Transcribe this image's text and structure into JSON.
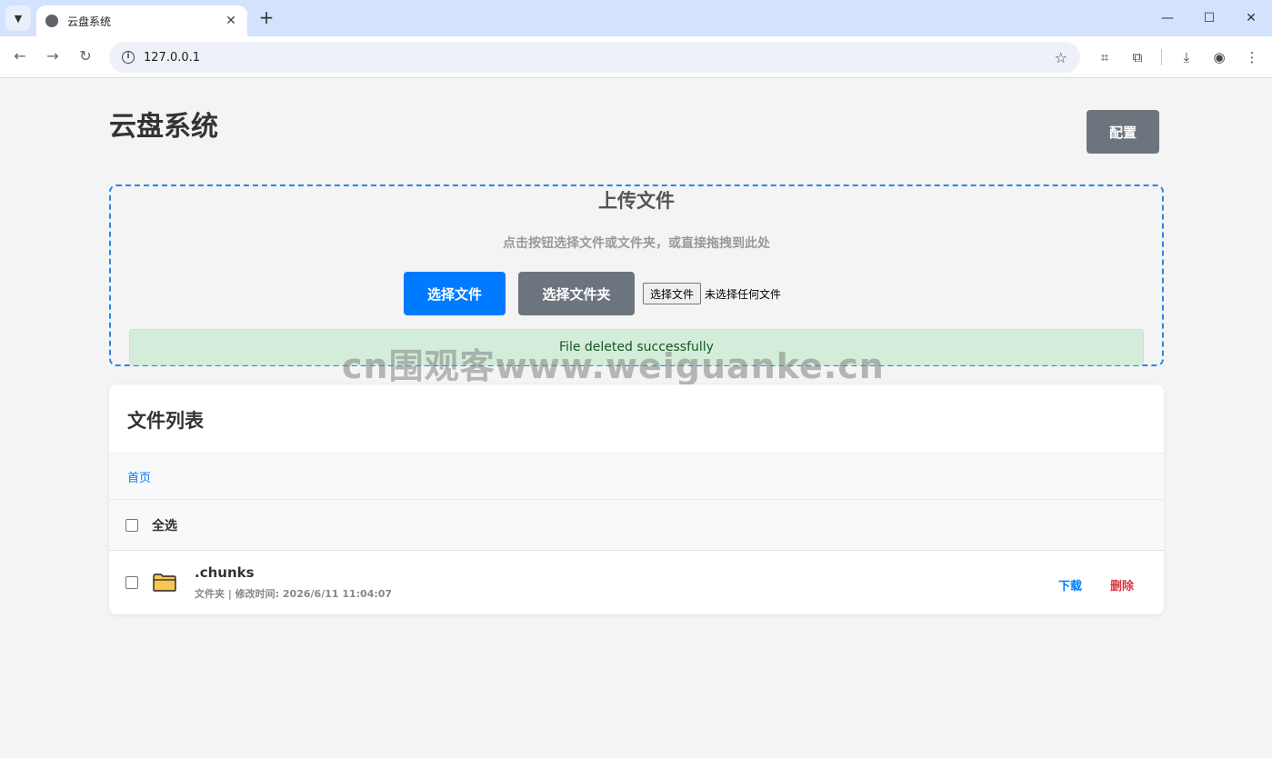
{
  "browser": {
    "tab_title": "云盘系统",
    "url": "127.0.0.1"
  },
  "page": {
    "title": "云盘系统",
    "config_label": "配置"
  },
  "upload": {
    "title": "上传文件",
    "hint": "点击按钮选择文件或文件夹，或直接拖拽到此处",
    "select_file_label": "选择文件",
    "select_folder_label": "选择文件夹",
    "native_file_button": "选择文件",
    "native_file_status": "未选择任何文件",
    "alert_message": "File deleted successfully"
  },
  "watermark": "cn围观客www.weiguanke.cn",
  "file_list": {
    "title": "文件列表",
    "breadcrumb_home": "首页",
    "select_all_label": "全选",
    "items": [
      {
        "name": ".chunks",
        "meta": "文件夹 | 修改时间: 2026/6/11 11:04:07",
        "download_label": "下载",
        "delete_label": "删除"
      }
    ]
  },
  "colors": {
    "primary": "#007bff",
    "secondary": "#6c757d",
    "danger": "#dc3545",
    "success_bg": "#d4edda",
    "success_text": "#155724",
    "dashed_border": "#2a86e8"
  }
}
